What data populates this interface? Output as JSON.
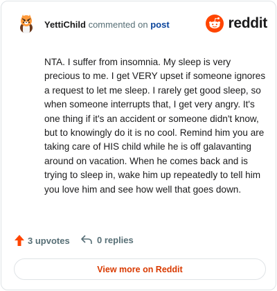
{
  "comment": {
    "username": "YettiChild",
    "verb": "commented on",
    "target_link": "post",
    "body": "NTA. I suffer from insomnia. My sleep is very precious to me. I get VERY upset if someone ignores a request to let me sleep. I rarely get good sleep, so when someone interrupts that, I get very angry. It's one thing if it's an accident or someone didn't know, but to knowingly do it is no cool. Remind him you are taking care of HIS child while he is off galavanting around on vacation. When he comes back and is trying to sleep in, wake him up repeatedly to tell him you love him and see how well that goes down."
  },
  "brand": {
    "wordmark": "reddit",
    "icon": "reddit-snoo-icon",
    "color": "#ff4500"
  },
  "footer": {
    "upvotes_label": "3 upvotes",
    "upvote_icon": "upvote-arrow-icon",
    "upvote_color": "#ff4500",
    "replies_label": "0 replies",
    "reply_icon": "reply-arrow-icon"
  },
  "actions": {
    "view_more_label": "View more on Reddit",
    "view_more_color": "#d93a00"
  }
}
